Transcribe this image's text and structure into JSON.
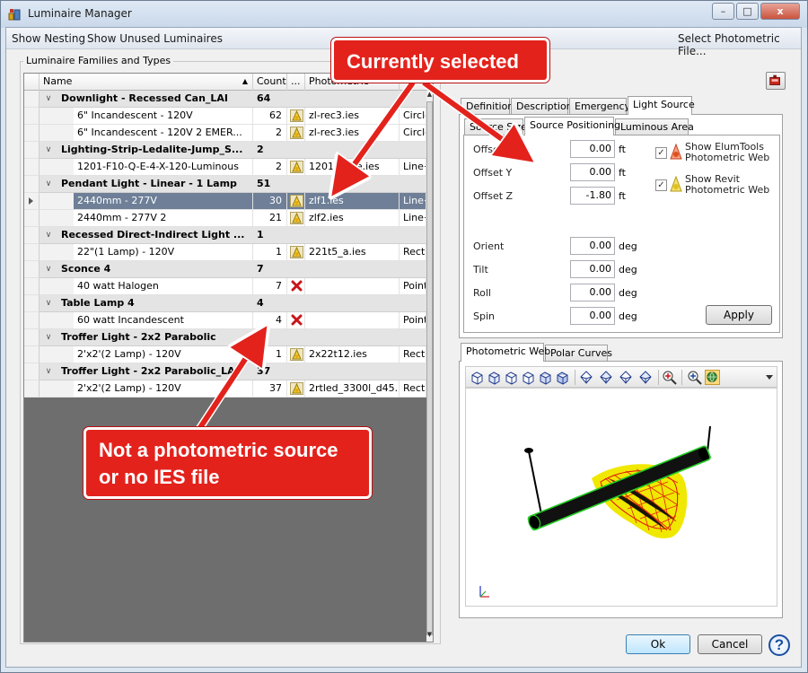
{
  "window": {
    "title": "Luminaire Manager",
    "minimize": "–",
    "maximize": "□",
    "close": "x"
  },
  "menu": {
    "show_nesting": "Show Nesting",
    "show_unused": "Show Unused Luminaires",
    "select_photometric": "Select Photometric File..."
  },
  "families": {
    "group_title": "Luminaire Families and Types",
    "columns": {
      "name": "Name",
      "count": "Count",
      "dots": "...",
      "photometric": "Photometric",
      "shape": ""
    },
    "groups": [
      {
        "name": "Downlight - Recessed Can_LAI",
        "count": "64"
      },
      {
        "name": "Lighting-Strip-Ledalite-Jump_S...",
        "count": "2"
      },
      {
        "name": "Pendant Light - Linear - 1 Lamp",
        "count": "51"
      },
      {
        "name": "Recessed Direct-Indirect Light ...",
        "count": "1"
      },
      {
        "name": "Sconce 4",
        "count": "7"
      },
      {
        "name": "Table Lamp 4",
        "count": "4"
      },
      {
        "name": "Troffer Light - 2x2 Parabolic",
        "count": "1"
      },
      {
        "name": "Troffer Light - 2x2 Parabolic_LAI",
        "count": "37"
      }
    ],
    "types": [
      {
        "name": "6\" Incandescent - 120V",
        "count": "62",
        "file": "zl-rec3.ies",
        "shape": "Circle+..."
      },
      {
        "name": "6\" Incandescent - 120V 2 EMER...",
        "count": "2",
        "file": "zl-rec3.ies",
        "shape": "Circle+..."
      },
      {
        "name": "1201-F10-Q-E-4-X-120-Luminous",
        "count": "2",
        "file": "1201f10qe.ies",
        "shape": "Line+Ph..."
      },
      {
        "name": "2440mm - 277V",
        "count": "30",
        "file": "zlf1.ies",
        "shape": "Line+Ph..."
      },
      {
        "name": "2440mm - 277V 2",
        "count": "21",
        "file": "zlf2.ies",
        "shape": "Line+Ph..."
      },
      {
        "name": "22\"(1 Lamp) - 120V",
        "count": "1",
        "file": "221t5_a.ies",
        "shape": "Rectan..."
      },
      {
        "name": "40 watt Halogen",
        "count": "7",
        "file": "",
        "shape": "Point+S..."
      },
      {
        "name": "60 watt Incandescent",
        "count": "4",
        "file": "",
        "shape": "Point+S..."
      },
      {
        "name": "2'x2'(2 Lamp) - 120V",
        "count": "1",
        "file": "2x22t12.ies",
        "shape": "Rectan..."
      },
      {
        "name": "2'x2'(2 Lamp) - 120V",
        "count": "37",
        "file": "2rtled_3300l_d45...",
        "shape": "Rectan..."
      }
    ]
  },
  "tabs": {
    "main": [
      "Definition",
      "Description",
      "Emergency",
      "Light Source"
    ],
    "sub": [
      "Source Size",
      "Source Positioning",
      "Luminous Area"
    ],
    "view": [
      "Photometric Web",
      "Polar Curves"
    ]
  },
  "positioning": {
    "offset_x": {
      "label": "Offset X",
      "value": "0.00",
      "unit": "ft"
    },
    "offset_y": {
      "label": "Offset Y",
      "value": "0.00",
      "unit": "ft"
    },
    "offset_z": {
      "label": "Offset Z",
      "value": "-1.80",
      "unit": "ft"
    },
    "orient": {
      "label": "Orient",
      "value": "0.00",
      "unit": "deg"
    },
    "tilt": {
      "label": "Tilt",
      "value": "0.00",
      "unit": "deg"
    },
    "roll": {
      "label": "Roll",
      "value": "0.00",
      "unit": "deg"
    },
    "spin": {
      "label": "Spin",
      "value": "0.00",
      "unit": "deg"
    },
    "show_elumtools_line1": "Show ElumTools",
    "show_elumtools_line2": "Photometric Web",
    "show_revit_line1": "Show Revit",
    "show_revit_line2": "Photometric Web",
    "apply": "Apply"
  },
  "footer": {
    "ok": "Ok",
    "cancel": "Cancel",
    "help": "?"
  },
  "callouts": {
    "selected": "Currently selected",
    "not_source_line1": "Not a photometric source",
    "not_source_line2": "or no IES file"
  },
  "colors": {
    "callout": "#e3221c",
    "selection": "#6e7f97",
    "web_red": "#e01010",
    "web_yellow": "#f0e800",
    "fixture_green": "#22cc22"
  }
}
